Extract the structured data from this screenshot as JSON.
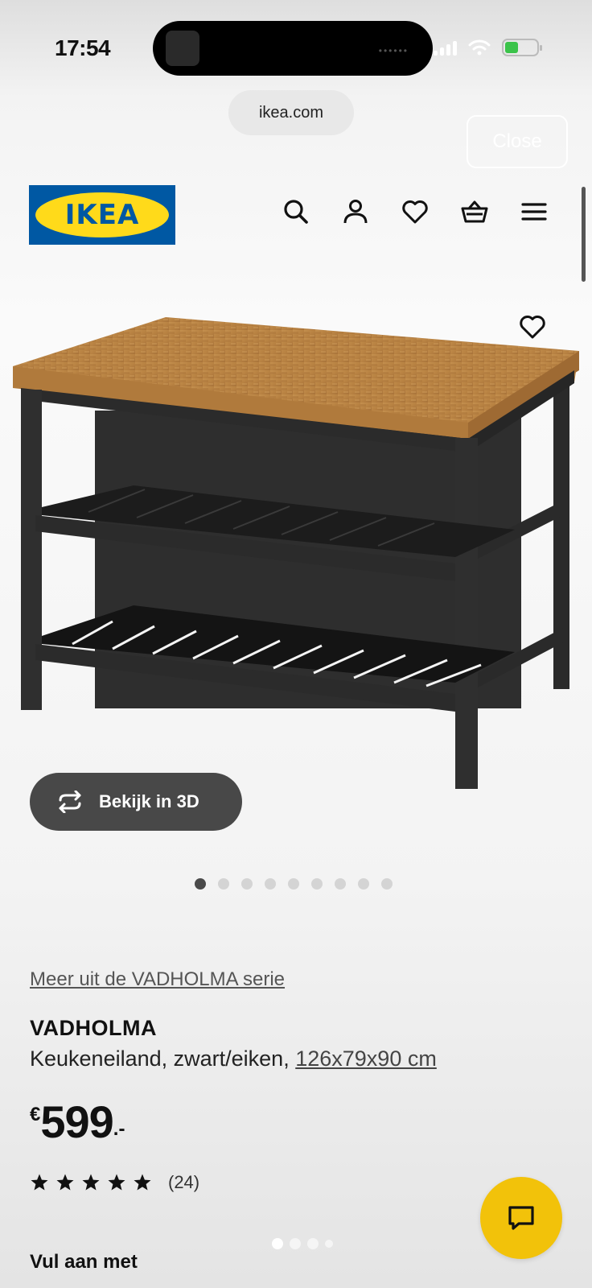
{
  "status_bar": {
    "time": "17:54",
    "battery_level": 0.35
  },
  "browser": {
    "url": "ikea.com",
    "close_label": "Close"
  },
  "header": {
    "logo_text": "IKEA",
    "icons": [
      "search-icon",
      "account-icon",
      "heart-icon",
      "basket-icon",
      "menu-icon"
    ]
  },
  "gallery": {
    "view_3d_label": "Bekijk in 3D",
    "image_count": 9,
    "active_index": 0
  },
  "product": {
    "series_link": "Meer uit de VADHOLMA serie",
    "name": "VADHOLMA",
    "description": "Keukeneiland, zwart/eiken,",
    "dimensions": "126x79x90 cm",
    "price": {
      "currency": "€",
      "value": "599",
      "suffix": ".-"
    },
    "rating": {
      "stars": 5,
      "count": "(24)"
    }
  },
  "section_title": "Vul aan met",
  "colors": {
    "ikea_blue": "#0058a3",
    "ikea_yellow": "#ffda1a",
    "chat_yellow": "#f2c20a"
  }
}
